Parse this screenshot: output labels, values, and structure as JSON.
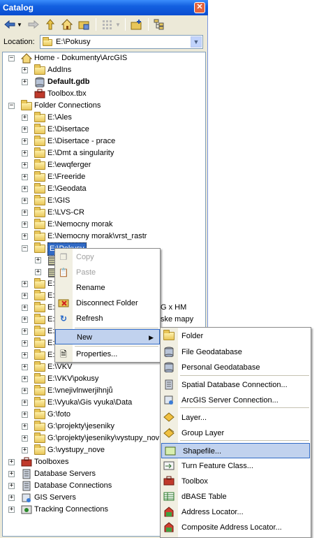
{
  "window": {
    "title": "Catalog",
    "close_glyph": "✕"
  },
  "toolbar": {
    "icons": [
      "back-arrow-icon",
      "dropdown-arrow-icon",
      "forward-arrow-icon",
      "up-folder-icon",
      "home-icon",
      "connect-folder-icon",
      "view-grid-icon",
      "new-folder-icon",
      "tree-toggle-icon"
    ]
  },
  "location": {
    "label": "Location:",
    "value": "E:\\Pokusy"
  },
  "tree": {
    "home": "Home - Dokumenty\\ArcGIS",
    "home_children": [
      "AddIns",
      "Default.gdb",
      "Toolbox.tbx"
    ],
    "folder_connections": "Folder Connections",
    "folders_top": [
      "E:\\Ales",
      "E:\\Disertace",
      "E:\\Disertace - prace",
      "E:\\Dmt a singularity",
      "E:\\ewqferger",
      "E:\\Freeride",
      "E:\\Geodata",
      "E:\\GIS",
      "E:\\LVS-CR",
      "E:\\Nemocny morak",
      "E:\\Nemocny morak\\vrst_rastr"
    ],
    "selected_folder": "E:\\Pokusy",
    "folders_hidden": [
      "E:",
      "E:",
      "E:",
      "E:",
      "E:",
      "E:",
      "E:"
    ],
    "partial_texts": [
      "G x HM",
      "ske mapy"
    ],
    "folders_bottom": [
      "E:\\VKV",
      "E:\\VKV\\pokusy",
      "E:\\vnejivlnwerjihnjů",
      "E:\\Vyuka\\Gis vyuka\\Data",
      "G:\\foto",
      "G:\\projekty\\jeseniky",
      "G:\\projekty\\jeseniky\\vystupy_nov",
      "G:\\vystupy_nove"
    ],
    "roots": [
      "Toolboxes",
      "Database Servers",
      "Database Connections",
      "GIS Servers",
      "Tracking Connections"
    ]
  },
  "context_menu": {
    "items": [
      {
        "label": "Copy",
        "icon": "copy-icon"
      },
      {
        "label": "Paste",
        "icon": "paste-icon"
      },
      {
        "label": "Rename",
        "icon": ""
      },
      {
        "label": "Disconnect Folder",
        "icon": "disconnect-folder-icon"
      },
      {
        "label": "Refresh",
        "icon": "refresh-icon"
      },
      {
        "label": "New",
        "icon": "",
        "arrow": "▶"
      },
      {
        "label": "Properties...",
        "icon": "properties-icon"
      }
    ]
  },
  "submenu": {
    "items": [
      {
        "label": "Folder"
      },
      {
        "label": "File Geodatabase"
      },
      {
        "label": "Personal Geodatabase"
      },
      {
        "label": "Spatial Database Connection..."
      },
      {
        "label": "ArcGIS Server Connection..."
      },
      {
        "label": "Layer..."
      },
      {
        "label": "Group Layer"
      },
      {
        "label": "Shapefile..."
      },
      {
        "label": "Turn Feature Class..."
      },
      {
        "label": "Toolbox"
      },
      {
        "label": "dBASE Table"
      },
      {
        "label": "Address Locator..."
      },
      {
        "label": "Composite Address Locator..."
      }
    ]
  },
  "colors": {
    "accent": "#316ac5",
    "highlight": "#c1d2ee",
    "titlebar": "#0a4dd0"
  }
}
